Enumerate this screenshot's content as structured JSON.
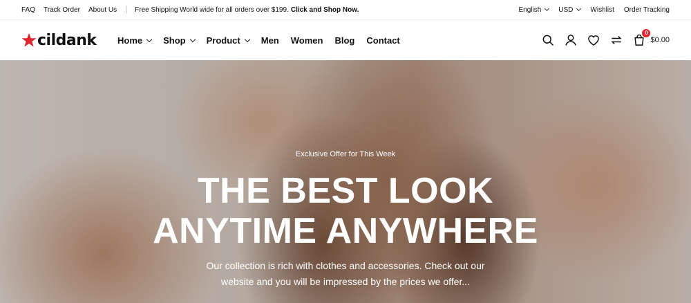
{
  "topbar": {
    "links": [
      "FAQ",
      "Track Order",
      "About Us"
    ],
    "promo": "Free Shipping World wide for all orders over $199.",
    "promo_link": "Click and Shop Now.",
    "language": "English",
    "currency": "USD",
    "wishlist": "Wishlist",
    "order_tracking": "Order Tracking"
  },
  "header": {
    "logo": "cildank",
    "nav": [
      {
        "label": "Home",
        "dropdown": true
      },
      {
        "label": "Shop",
        "dropdown": true
      },
      {
        "label": "Product",
        "dropdown": true
      },
      {
        "label": "Men",
        "dropdown": false
      },
      {
        "label": "Women",
        "dropdown": false
      },
      {
        "label": "Blog",
        "dropdown": false
      },
      {
        "label": "Contact",
        "dropdown": false
      }
    ],
    "icons": [
      "search-icon",
      "user-icon",
      "heart-icon",
      "compare-icon",
      "cart-icon"
    ],
    "cart_count": "0",
    "cart_total": "$0.00"
  },
  "hero": {
    "eyebrow": "Exclusive Offer for This Week",
    "title_line1": "THE BEST LOOK",
    "title_line2": "ANYTIME ANYWHERE",
    "desc_line1": "Our collection is rich with clothes and accessories. Check out our",
    "desc_line2": "website and you will be impressed by the prices we offer..."
  },
  "colors": {
    "brand_red": "#e0262d",
    "text": "#111111"
  }
}
